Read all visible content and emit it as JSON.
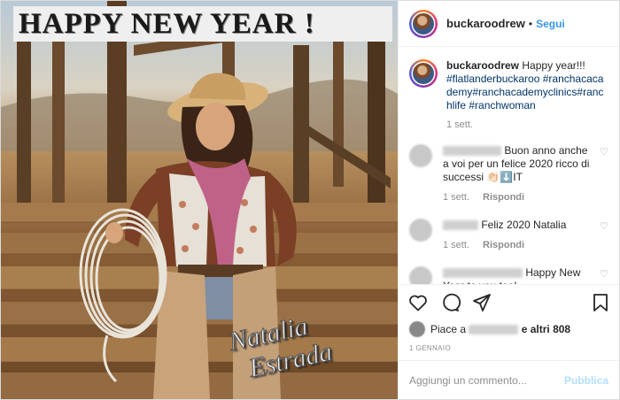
{
  "photo": {
    "banner": "HAPPY NEW YEAR !",
    "signature_line1": "Natalia",
    "signature_line2": "Estrada"
  },
  "header": {
    "username": "buckaroodrew",
    "separator": "•",
    "follow_label": "Segui",
    "more_icon": "more-horizontal-icon"
  },
  "caption": {
    "username": "buckaroodrew",
    "text": "Happy year!!!",
    "hashtags": "#flatlanderbuckaroo #ranchacacademy#ranchacademyclinics#ranchlife #ranchwoman",
    "time": "1 sett."
  },
  "comments": [
    {
      "text": "Buon anno anche a voi per un felice 2020 ricco di successi 👏🏻⬇️IT",
      "time": "1 sett.",
      "reply": "Rispondi"
    },
    {
      "text": "Feliz 2020 Natalia",
      "time": "1 sett.",
      "reply": "Rispondi"
    },
    {
      "text": "Happy New Year to you too!"
    }
  ],
  "likes": {
    "prefix": "Piace a",
    "suffix": "e altri 808"
  },
  "date": "1 GENNAIO",
  "add_comment": {
    "placeholder": "Aggiungi un commento...",
    "publish_label": "Pubblica"
  },
  "colors": {
    "link": "#3897f0",
    "hashtag": "#003569",
    "muted": "#8e8e8e",
    "publish_disabled": "#b2dffc"
  }
}
